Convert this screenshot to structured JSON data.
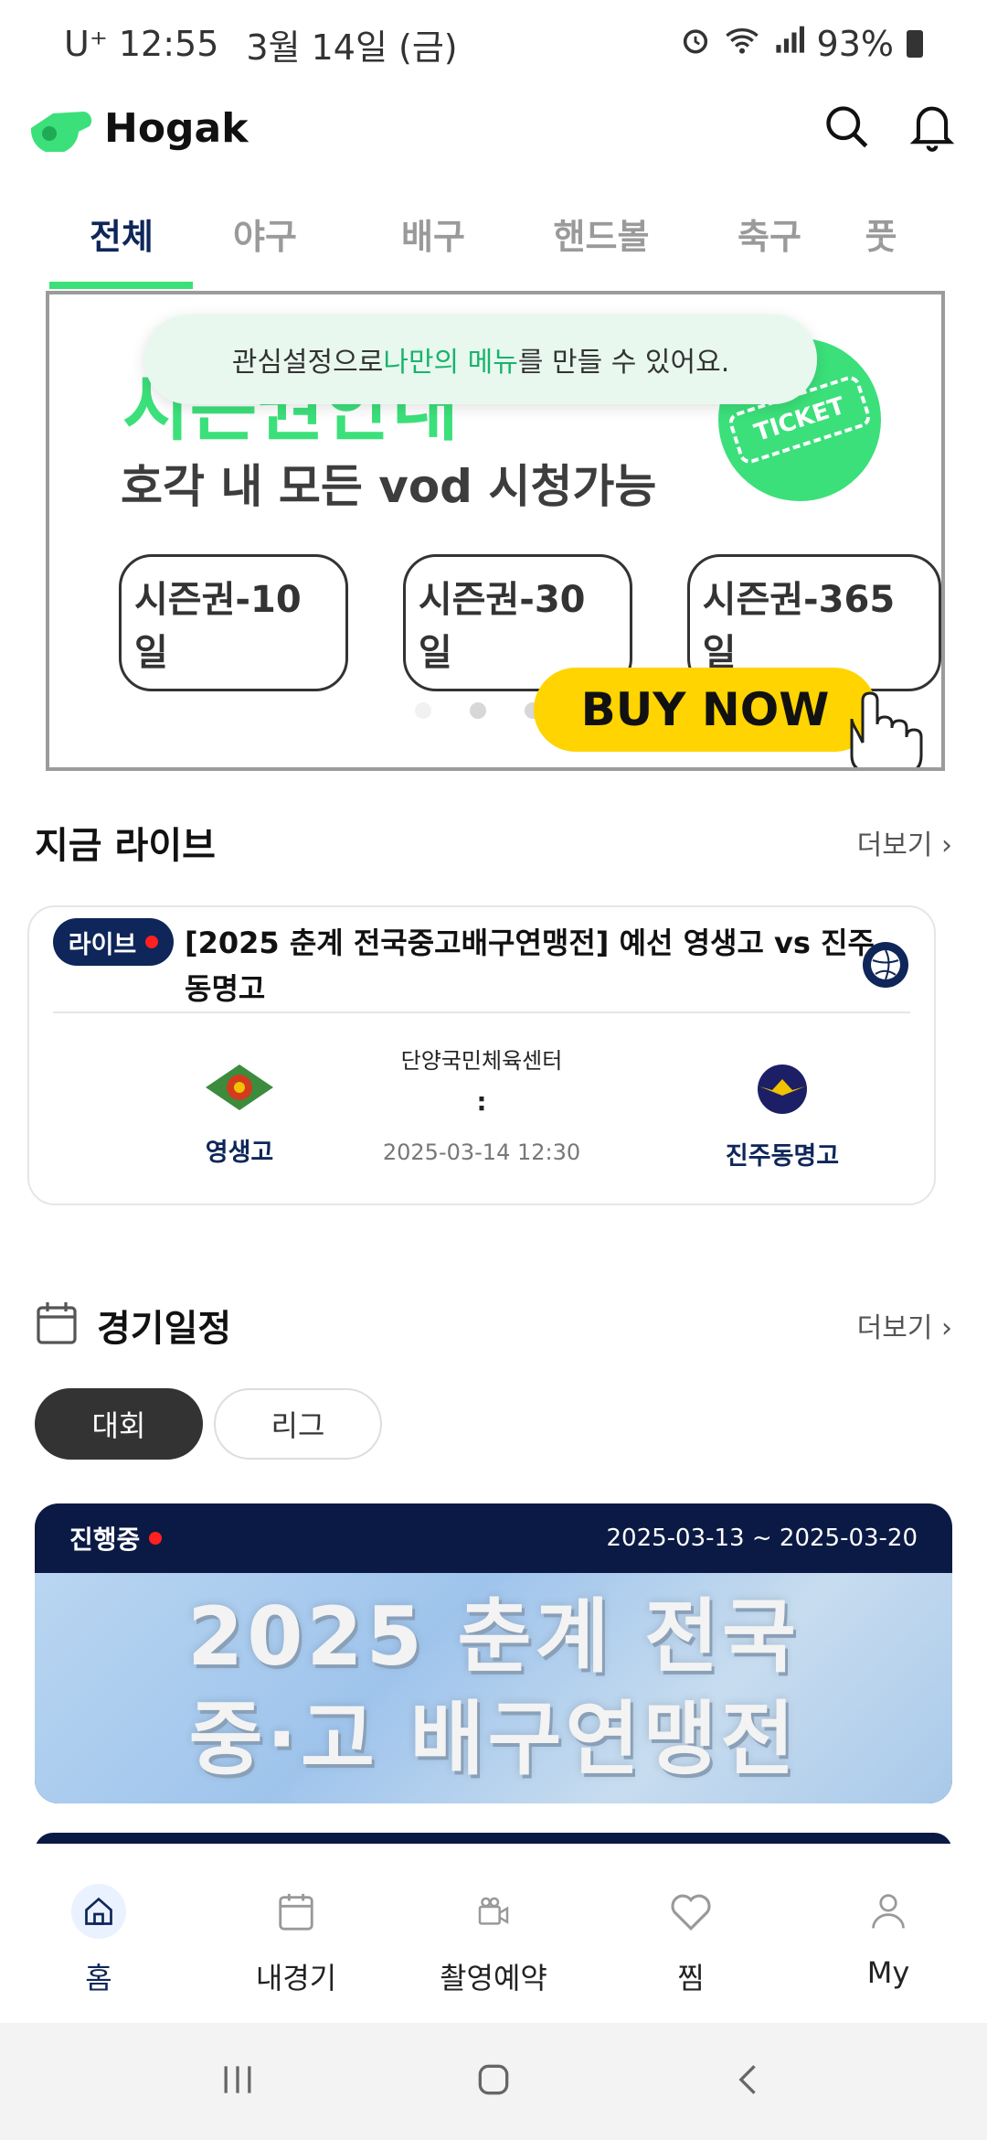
{
  "status_bar": {
    "carrier": "U⁺",
    "time": "12:55",
    "date": "3월 14일 (금)",
    "battery": "93%"
  },
  "header": {
    "app_name": "Hogak"
  },
  "tabs": [
    "전체",
    "야구",
    "배구",
    "핸드볼",
    "축구",
    "풋"
  ],
  "banner": {
    "headline": "시즌권안내",
    "subtitle": "호각 내 모든 vod 시청가능",
    "ticket_label": "TICKET",
    "passes": [
      "시즌권-10일",
      "시즌권-30일",
      "시즌권-365일"
    ],
    "buy_label": "BUY NOW",
    "tooltip_pre": "관심설정으로 ",
    "tooltip_highlight": "나만의 메뉴",
    "tooltip_post": "를 만들 수 있어요."
  },
  "live_section": {
    "title": "지금 라이브",
    "more": "더보기",
    "card": {
      "badge": "라이브",
      "title": "[2025 춘계 전국중고배구연맹전] 예선 영생고 vs 진주동명고",
      "home_team": "영생고",
      "away_team": "진주동명고",
      "venue": "단양국민체육센터",
      "score": ":",
      "datetime": "2025-03-14 12:30"
    }
  },
  "schedule_section": {
    "title": "경기일정",
    "more": "더보기",
    "segments": [
      "대회",
      "리그"
    ],
    "event": {
      "status": "진행중",
      "date_range": "2025-03-13 ~ 2025-03-20",
      "image_text_line1": "2025 춘계 전국",
      "image_text_line2": "중·고 배구연맹전"
    }
  },
  "bottom_nav": [
    {
      "label": "홈",
      "icon": "home-icon"
    },
    {
      "label": "내경기",
      "icon": "calendar-icon"
    },
    {
      "label": "촬영예약",
      "icon": "camera-icon"
    },
    {
      "label": "찜",
      "icon": "heart-icon"
    },
    {
      "label": "My",
      "icon": "user-icon"
    }
  ],
  "colors": {
    "brand_green": "#3be07a",
    "navy": "#0e2659",
    "live_red": "#ff2020",
    "buy_yellow": "#ffd400"
  }
}
